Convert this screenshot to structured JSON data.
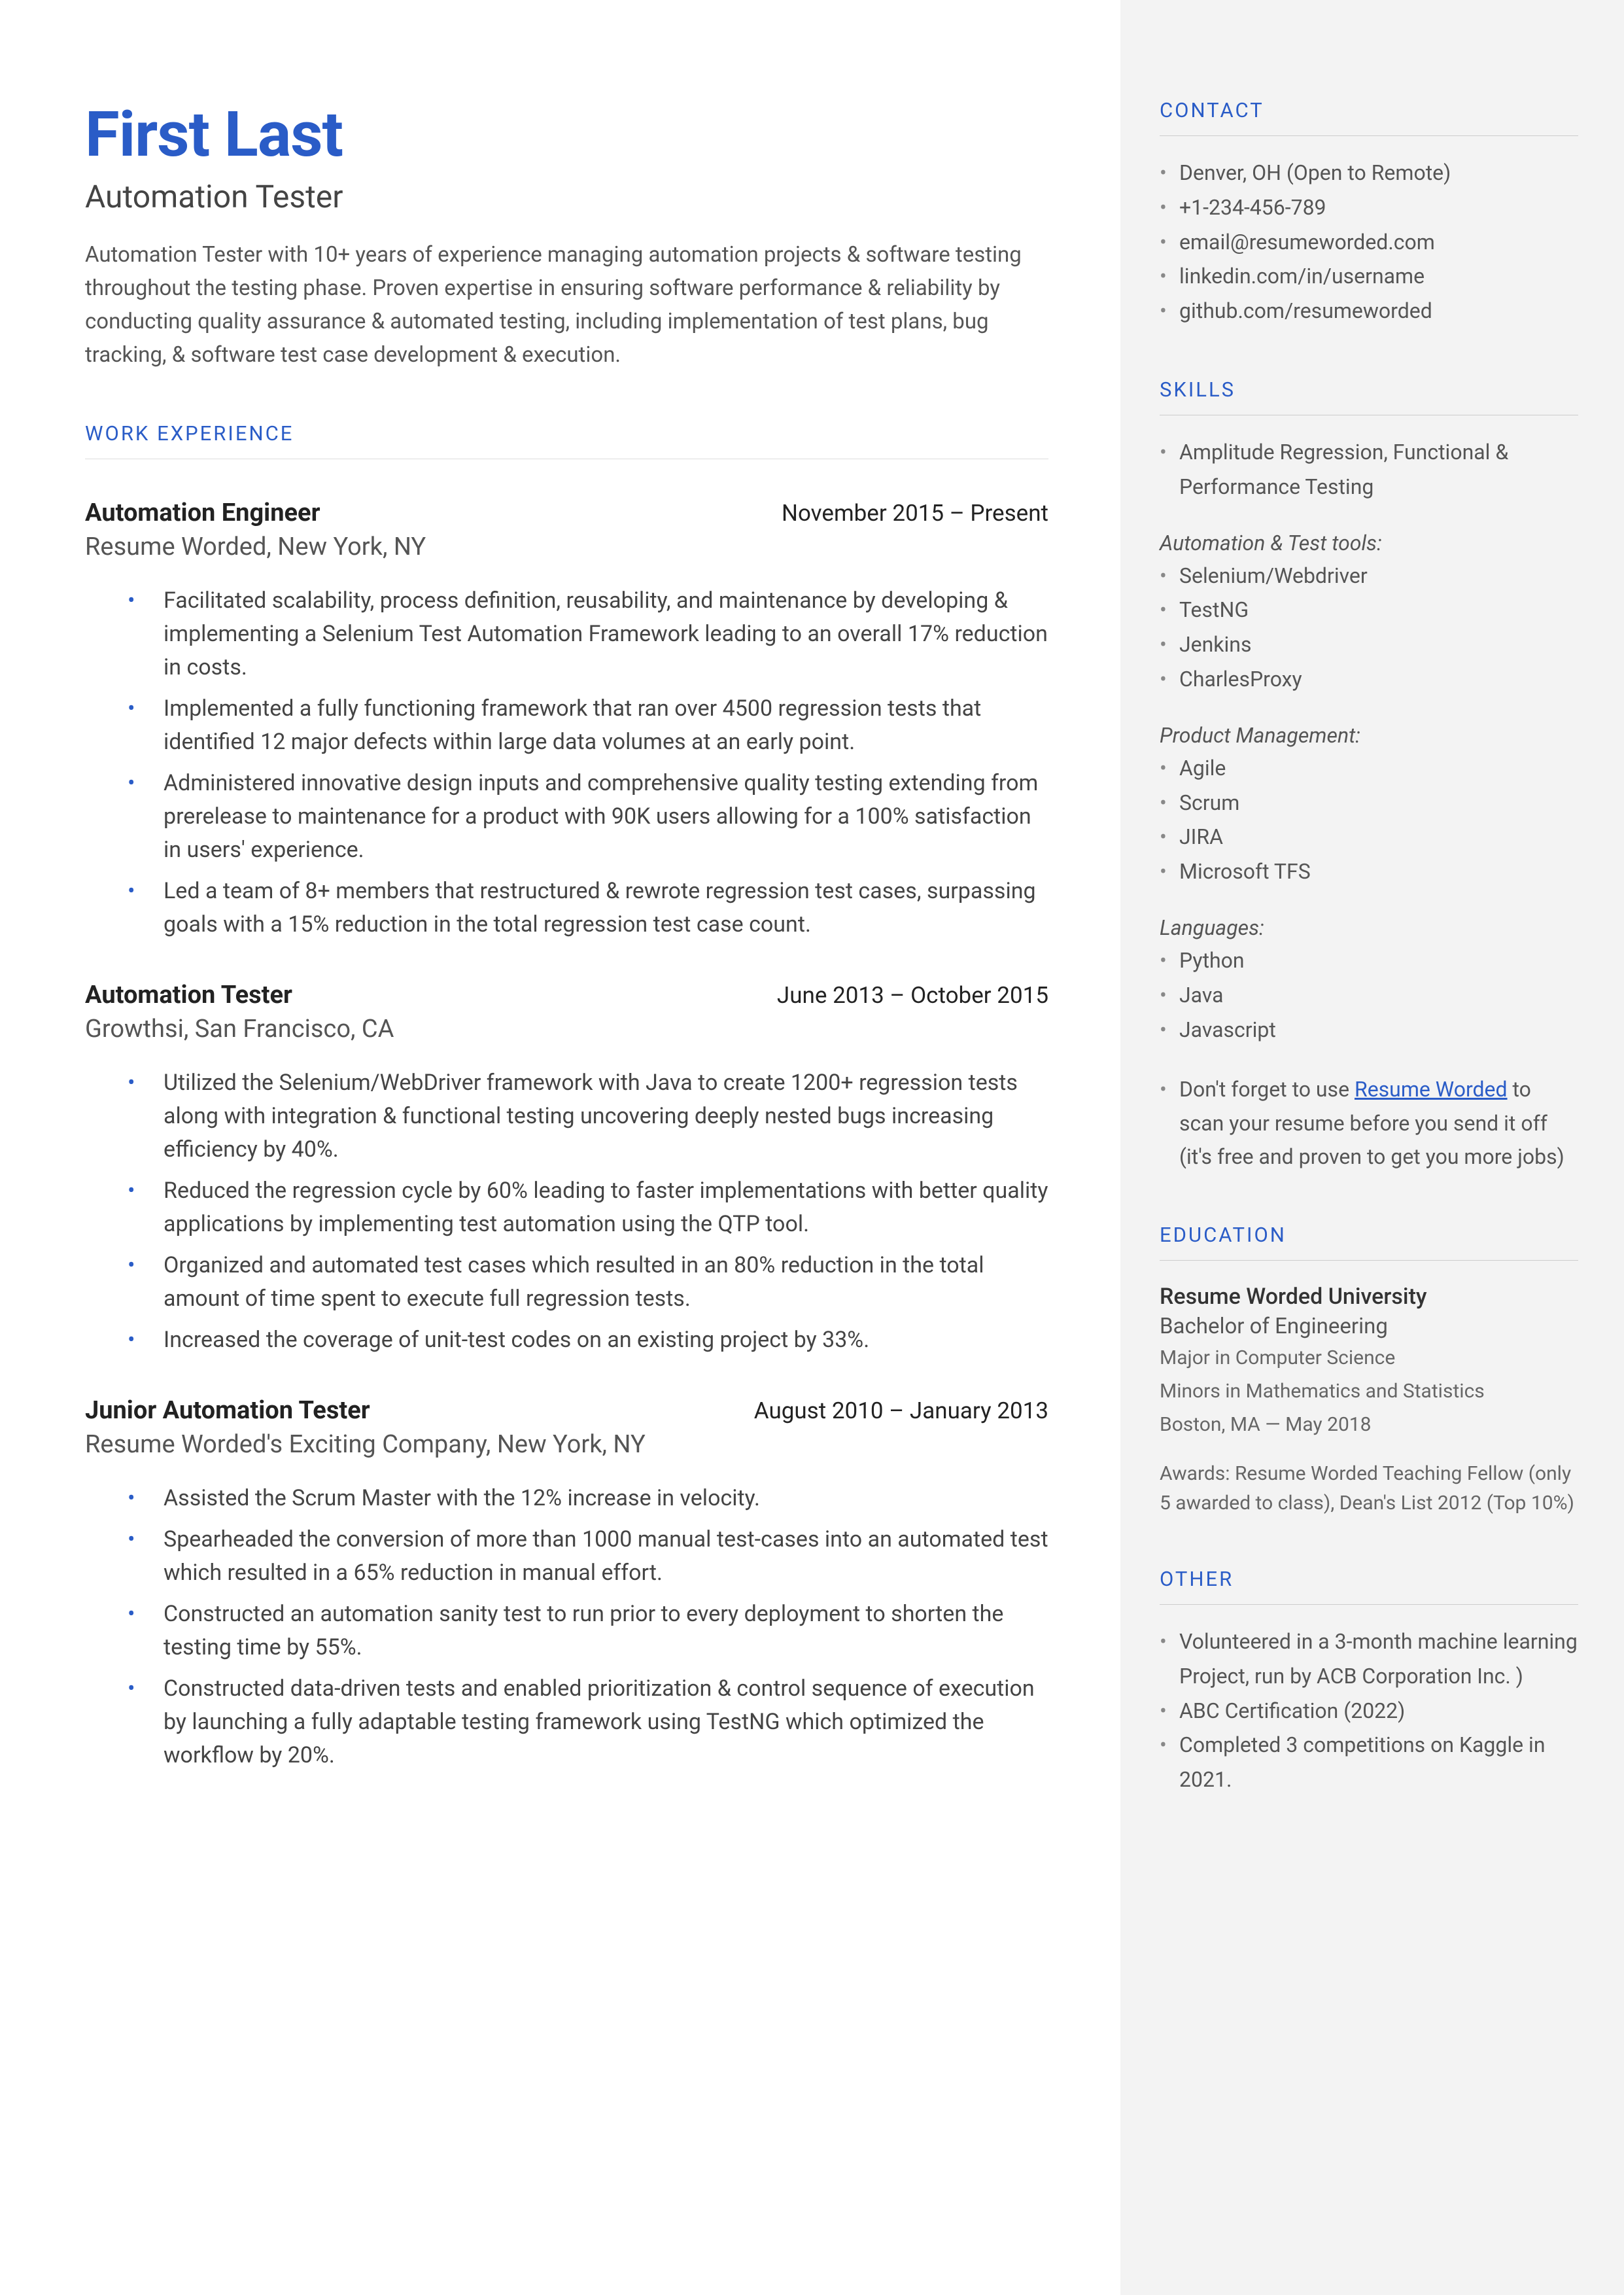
{
  "name": "First Last",
  "title": "Automation Tester",
  "summary": "Automation Tester with 10+ years of experience managing automation projects & software testing throughout the testing phase. Proven expertise in ensuring software performance & reliability by conducting quality assurance & automated testing, including implementation of test plans, bug tracking, & software test case development & execution.",
  "sections": {
    "work": "WORK EXPERIENCE",
    "contact": "CONTACT",
    "skills": "SKILLS",
    "education": "EDUCATION",
    "other": "OTHER"
  },
  "jobs": [
    {
      "title": "Automation Engineer",
      "dates": "November 2015 – Present",
      "company": "Resume Worded, New York, NY",
      "bullets": [
        "Facilitated scalability, process definition, reusability, and maintenance by developing & implementing a Selenium Test Automation Framework leading to an overall 17% reduction in costs.",
        "Implemented a fully functioning framework that ran over 4500 regression tests that identified 12 major defects within large data volumes at an early point.",
        "Administered innovative design inputs and comprehensive quality testing extending from prerelease to maintenance for a product with 90K users allowing for a 100% satisfaction in users' experience.",
        "Led a team of 8+ members that restructured & rewrote regression test cases, surpassing goals with a 15% reduction in the total regression test case count."
      ]
    },
    {
      "title": "Automation Tester",
      "dates": "June 2013 – October 2015",
      "company": "Growthsi, San Francisco, CA",
      "bullets": [
        "Utilized the Selenium/WebDriver framework with Java to create 1200+ regression tests along with integration & functional testing uncovering deeply nested bugs increasing efficiency by 40%.",
        "Reduced the regression cycle by 60% leading to faster implementations with better quality applications by implementing test automation using the QTP tool.",
        "Organized and automated test cases which resulted in an 80% reduction in the total amount of time spent to execute full regression tests.",
        "Increased the coverage of unit-test codes on an existing project by 33%."
      ]
    },
    {
      "title": "Junior Automation Tester",
      "dates": "August 2010 – January 2013",
      "company": "Resume Worded's Exciting Company, New York, NY",
      "bullets": [
        "Assisted the Scrum Master with the 12% increase in velocity.",
        "Spearheaded the conversion of more than 1000 manual test-cases into an automated test which resulted in a 65% reduction in manual effort.",
        "Constructed an automation sanity test to run prior to every deployment to shorten the testing time by 55%.",
        "Constructed data-driven tests and enabled prioritization & control sequence of execution by launching a fully adaptable testing framework using TestNG which optimized the workflow by 20%."
      ]
    }
  ],
  "contact": [
    "Denver, OH (Open to Remote)",
    "+1-234-456-789",
    "email@resumeworded.com",
    "linkedin.com/in/username",
    "github.com/resumeworded"
  ],
  "skills": {
    "top": "Amplitude Regression, Functional & Performance Testing",
    "groups": [
      {
        "title": "Automation & Test tools:",
        "items": [
          "Selenium/Webdriver",
          "TestNG",
          "Jenkins",
          "CharlesProxy"
        ]
      },
      {
        "title": "Product Management:",
        "items": [
          "Agile",
          "Scrum",
          "JIRA",
          "Microsoft TFS"
        ]
      },
      {
        "title": "Languages:",
        "items": [
          "Python",
          "Java",
          "Javascript"
        ]
      }
    ],
    "tip_prefix": "Don't forget to use ",
    "tip_link": "Resume Worded",
    "tip_suffix": " to scan your resume before you send it off (it's free and proven to get you more jobs)"
  },
  "education": {
    "school": "Resume Worded University",
    "degree": "Bachelor of Engineering",
    "major": "Major in Computer Science",
    "minors": "Minors in Mathematics and Statistics",
    "location": "Boston, MA — May 2018",
    "awards": "Awards: Resume Worded Teaching Fellow (only 5 awarded to class), Dean's List 2012 (Top 10%)"
  },
  "other": [
    "Volunteered in a 3-month machine learning Project, run by ACB Corporation Inc. )",
    "ABC Certification (2022)",
    "Completed 3 competitions on Kaggle in 2021."
  ]
}
